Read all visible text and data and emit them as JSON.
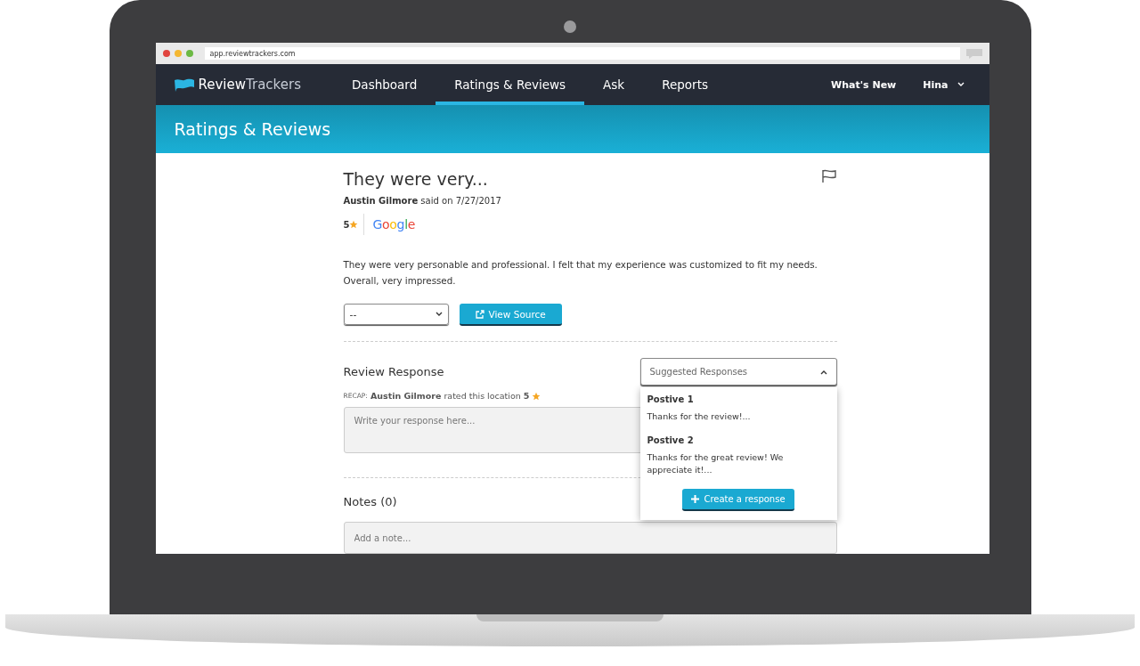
{
  "browser": {
    "url": "app.reviewtrackers.com"
  },
  "nav": {
    "brand_bold": "Review",
    "brand_light": "Trackers",
    "items": [
      {
        "label": "Dashboard",
        "selected": false
      },
      {
        "label": "Ratings & Reviews",
        "selected": true
      },
      {
        "label": "Ask",
        "selected": false
      },
      {
        "label": "Reports",
        "selected": false
      }
    ],
    "whats_new": "What's New",
    "user": "Hina"
  },
  "header": {
    "title": "Ratings & Reviews"
  },
  "review": {
    "title": "They were very...",
    "byline": "**Austin Gilmore** said on 7/27/2017",
    "rating": "5",
    "source": "Google",
    "body": "They were very personable and professional. I felt that my experience was customized to fit my needs. Overall, very impressed.",
    "select_value": "--",
    "view_source": "View Source"
  },
  "response": {
    "title": "Review Response",
    "recap_label": "RECAP:",
    "recap": "**Austin Gilmore** rated this location **5**",
    "placeholder": "Write your response here...",
    "suggested": {
      "label": "Suggested Responses",
      "expanded": true,
      "items": [
        {
          "name": "Postive 1",
          "text": "Thanks for the review!..."
        },
        {
          "name": "Postive 2",
          "text": "Thanks for the great review! We appreciate it!..."
        }
      ],
      "create": "Create a response"
    }
  },
  "notes": {
    "title": "Notes (0)",
    "placeholder": "Add a note..."
  }
}
